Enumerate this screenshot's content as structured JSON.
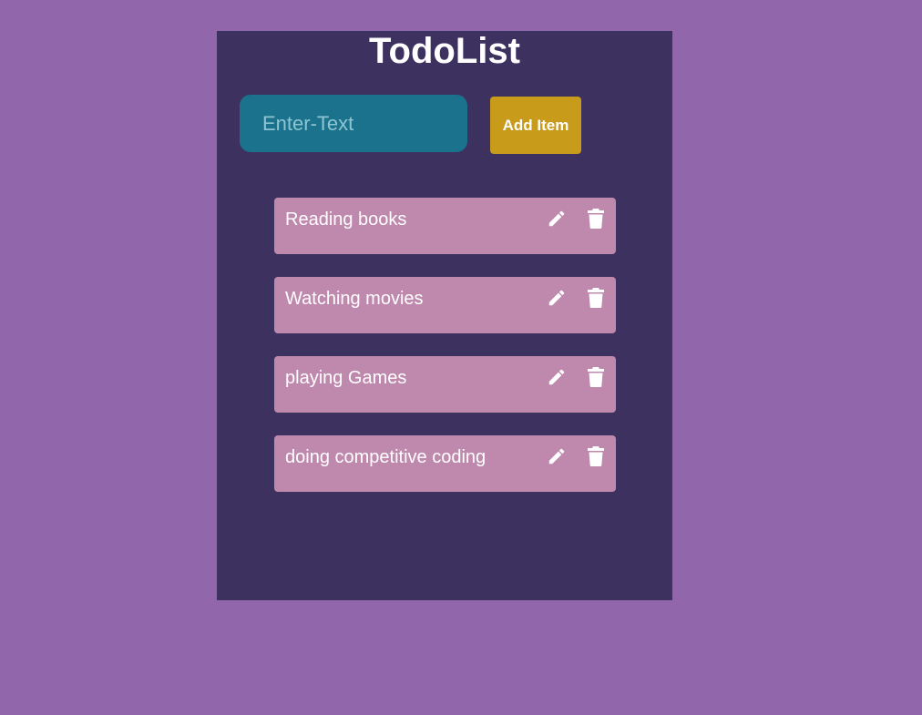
{
  "app": {
    "title": "TodoList"
  },
  "input": {
    "placeholder": "Enter-Text",
    "value": ""
  },
  "add_button": {
    "label": "Add Item"
  },
  "todos": [
    {
      "text": "Reading books",
      "edit_icon": "pencil-icon",
      "delete_icon": "trash-icon"
    },
    {
      "text": "Watching movies",
      "edit_icon": "pencil-icon",
      "delete_icon": "trash-icon"
    },
    {
      "text": "playing Games",
      "edit_icon": "pencil-icon",
      "delete_icon": "trash-icon"
    },
    {
      "text": "doing competitive coding",
      "edit_icon": "pencil-icon",
      "delete_icon": "trash-icon"
    }
  ],
  "colors": {
    "page_background": "#9166aa",
    "panel_background": "#3d3160",
    "input_background": "#1b728c",
    "button_background": "#c99b1a",
    "item_background": "#bf88ad",
    "text": "#ffffff"
  }
}
